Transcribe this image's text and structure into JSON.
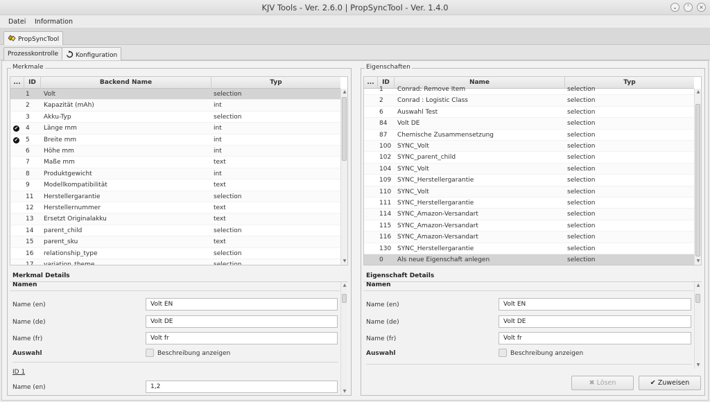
{
  "window": {
    "title": "KJV Tools - Ver. 2.6.0 | PropSyncTool - Ver. 1.4.0"
  },
  "menu": {
    "items": [
      "Datei",
      "Information"
    ]
  },
  "tabs": {
    "main": "PropSyncTool",
    "sub1": "Prozesskontrolle",
    "sub2": "Konfiguration"
  },
  "merkmale": {
    "legend": "Merkmale",
    "headers": {
      "dots": "...",
      "id": "ID",
      "name": "Backend Name",
      "type": "Typ"
    },
    "rows": [
      {
        "id": "1",
        "name": "Volt",
        "type": "selection",
        "checked": false,
        "selected": true
      },
      {
        "id": "2",
        "name": "Kapazität (mAh)",
        "type": "int",
        "checked": false
      },
      {
        "id": "3",
        "name": "Akku-Typ",
        "type": "selection",
        "checked": false
      },
      {
        "id": "4",
        "name": "Länge mm",
        "type": "int",
        "checked": true
      },
      {
        "id": "5",
        "name": "Breite mm",
        "type": "int",
        "checked": true
      },
      {
        "id": "6",
        "name": "Höhe mm",
        "type": "int",
        "checked": false
      },
      {
        "id": "7",
        "name": "Maße mm",
        "type": "text",
        "checked": false
      },
      {
        "id": "8",
        "name": "Produktgewicht",
        "type": "int",
        "checked": false
      },
      {
        "id": "9",
        "name": "Modellkompatibilität",
        "type": "text",
        "checked": false
      },
      {
        "id": "11",
        "name": "Herstellergarantie",
        "type": "selection",
        "checked": false
      },
      {
        "id": "12",
        "name": "Herstellernummer",
        "type": "text",
        "checked": false
      },
      {
        "id": "13",
        "name": "Ersetzt Originalakku",
        "type": "text",
        "checked": false
      },
      {
        "id": "14",
        "name": "parent_child",
        "type": "selection",
        "checked": false
      },
      {
        "id": "15",
        "name": "parent_sku",
        "type": "text",
        "checked": false
      },
      {
        "id": "16",
        "name": "relationship_type",
        "type": "selection",
        "checked": false
      },
      {
        "id": "17",
        "name": "variation_theme",
        "type": "selection",
        "checked": false
      }
    ]
  },
  "merkmal_details": {
    "title": "Merkmal Details",
    "section": "Namen",
    "name_en_label": "Name (en)",
    "name_en_value": "Volt EN",
    "name_de_label": "Name (de)",
    "name_de_value": "Volt DE",
    "name_fr_label": "Name (fr)",
    "name_fr_value": "Volt fr",
    "auswahl_label": "Auswahl",
    "checkbox_label": "Beschreibung anzeigen",
    "id_label": "ID 1",
    "name_en2_label": "Name (en)",
    "name_en2_value": "1,2"
  },
  "eigenschaften": {
    "legend": "Eigenschaften",
    "headers": {
      "dots": "...",
      "id": "ID",
      "name": "Name",
      "type": "Typ"
    },
    "rows": [
      {
        "id": "1",
        "name": "Conrad: Remove Item",
        "type": "selection"
      },
      {
        "id": "2",
        "name": "Conrad : Logistic Class",
        "type": "selection"
      },
      {
        "id": "6",
        "name": "Auswahl Test",
        "type": "selection"
      },
      {
        "id": "84",
        "name": "Volt DE",
        "type": "selection"
      },
      {
        "id": "87",
        "name": "Chemische Zusammensetzung",
        "type": "selection"
      },
      {
        "id": "100",
        "name": "SYNC_Volt",
        "type": "selection"
      },
      {
        "id": "102",
        "name": "SYNC_parent_child",
        "type": "selection"
      },
      {
        "id": "104",
        "name": "SYNC_Volt",
        "type": "selection"
      },
      {
        "id": "109",
        "name": "SYNC_Herstellergarantie",
        "type": "selection"
      },
      {
        "id": "110",
        "name": "SYNC_Volt",
        "type": "selection"
      },
      {
        "id": "111",
        "name": "SYNC_Herstellergarantie",
        "type": "selection"
      },
      {
        "id": "114",
        "name": "SYNC_Amazon-Versandart",
        "type": "selection"
      },
      {
        "id": "115",
        "name": "SYNC_Amazon-Versandart",
        "type": "selection"
      },
      {
        "id": "116",
        "name": "SYNC_Amazon-Versandart",
        "type": "selection"
      },
      {
        "id": "130",
        "name": "SYNC_Herstellergarantie",
        "type": "selection"
      },
      {
        "id": "0",
        "name": "Als neue Eigenschaft anlegen",
        "type": "selection",
        "selected": true
      }
    ]
  },
  "eigenschaft_details": {
    "title": "Eigenschaft Details",
    "section": "Namen",
    "name_en_label": "Name (en)",
    "name_en_value": "Volt EN",
    "name_de_label": "Name (de)",
    "name_de_value": "Volt DE",
    "name_fr_label": "Name (fr)",
    "name_fr_value": "Volt fr",
    "auswahl_label": "Auswahl",
    "checkbox_label": "Beschreibung anzeigen"
  },
  "buttons": {
    "loesen": "Lösen",
    "zuweisen": "Zuweisen"
  },
  "icons": {
    "check": "check-circle-icon",
    "loesen": "x-icon",
    "zuweisen": "check-icon",
    "refresh": "refresh-icon",
    "app": "puzzle-icon"
  }
}
